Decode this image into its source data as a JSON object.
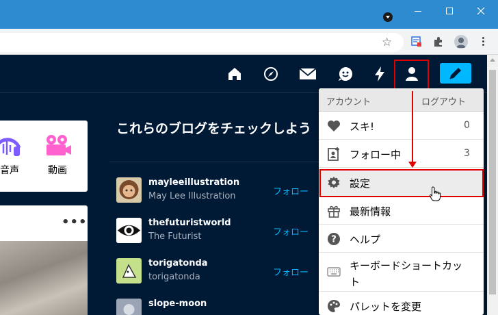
{
  "browser": {
    "address_text": "",
    "icons": [
      "profile-dropdown-icon",
      "minimize-icon",
      "maximize-icon",
      "close-icon",
      "bookmark-star-icon",
      "extension-icon",
      "puzzle-icon",
      "profile-icon",
      "menu-icon"
    ]
  },
  "nav": {
    "icons": [
      "home-icon",
      "explore-icon",
      "inbox-icon",
      "messages-icon",
      "activity-icon",
      "account-icon",
      "compose-icon"
    ],
    "accent": "#00b8ff",
    "background": "#001935"
  },
  "left_panel": {
    "post_types": [
      {
        "label": "音声",
        "icon": "audio-icon",
        "color": "#7c5cff"
      },
      {
        "label": "動画",
        "icon": "video-icon",
        "color": "#ff62ce"
      }
    ],
    "more_label": "•••"
  },
  "recommended": {
    "title": "これらのブログをチェックしよう",
    "follow_label": "フォロー",
    "blogs": [
      {
        "name": "mayleeillustration",
        "title": "May Lee Illustration"
      },
      {
        "name": "thefuturistworld",
        "title": "The Futurist"
      },
      {
        "name": "torigatonda",
        "title": "torigatonda"
      },
      {
        "name": "slope-moon",
        "title": ""
      }
    ]
  },
  "account_menu": {
    "header_label": "アカウント",
    "logout_label": "ログアウト",
    "items": [
      {
        "label": "スキ!",
        "icon": "heart-icon",
        "count": "0"
      },
      {
        "label": "フォロー中",
        "icon": "following-icon",
        "count": "3"
      },
      {
        "label": "設定",
        "icon": "gear-icon",
        "count": ""
      },
      {
        "label": "最新情報",
        "icon": "gift-icon",
        "count": ""
      },
      {
        "label": "ヘルプ",
        "icon": "help-icon",
        "count": ""
      },
      {
        "label": "キーボードショートカット",
        "icon": "keyboard-icon",
        "count": ""
      },
      {
        "label": "パレットを変更",
        "icon": "palette-icon",
        "count": ""
      }
    ],
    "highlight_color": "#e00000"
  }
}
